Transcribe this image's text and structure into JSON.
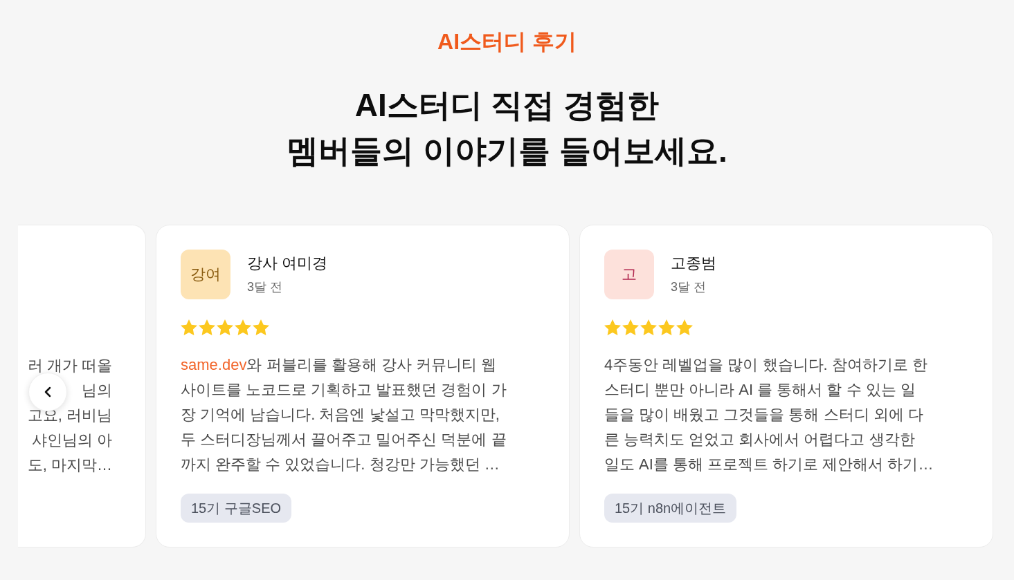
{
  "section": {
    "eyebrow": "AI스터디 후기",
    "heading_lines": [
      "AI스터디 직접 경험한",
      "멤버들의 이야기를 들어보세요."
    ]
  },
  "reviews": [
    {
      "kind": "partial",
      "lines": [
        "러 개가 떠올",
        "님의",
        "고요, 러비님",
        "샤인님의 아",
        "도, 마지막…"
      ]
    },
    {
      "kind": "full",
      "avatar": {
        "color": "#fde3b4",
        "initials": {
          "text": "강여",
          "color": "#8a5c10"
        }
      },
      "name": "강사 여미경",
      "time": "3달 전",
      "stars": 5,
      "link": "same.dev",
      "lines": [
        "와 퍼블리를 활용해 강사 커뮤니티 웹",
        "사이트를 노코드로 기획하고 발표했던 경험이 가",
        "장 기억에 남습니다. 처음엔 낯설고 막막했지만,",
        "두 스터디장님께서 끌어주고 밀어주신 덕분에 끝",
        "까지 완주할 수 있었습니다. 청강만 가능했던 …"
      ],
      "tag": "15기 구글SEO"
    },
    {
      "kind": "full",
      "avatar": {
        "color": "#fde1db",
        "initials": {
          "text": "고",
          "color": "#b1264e"
        }
      },
      "name": "고종범",
      "time": "3달 전",
      "stars": 5,
      "lines": [
        "4주동안 레벨업을 많이 했습니다. 참여하기로 한",
        "스터디 뿐만 아니라 AI 를 통해서 할 수 있는 일",
        "들을 많이 배웠고 그것들을 통해 스터디 외에 다",
        "른 능력치도 얻었고 회사에서 어렵다고 생각한",
        "일도 AI를 통해 프로젝트 하기로 제안해서 하기…"
      ],
      "tag": "15기 n8n에이전트"
    }
  ]
}
